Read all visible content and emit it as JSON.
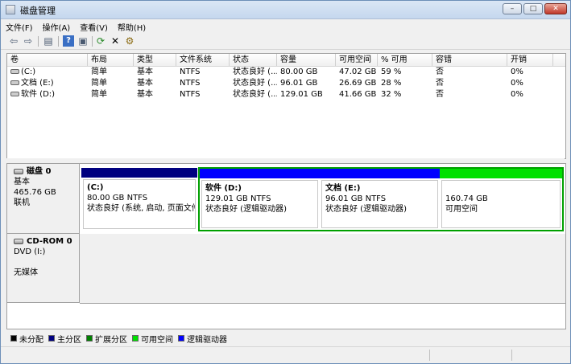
{
  "window": {
    "title": "磁盘管理",
    "buttons": [
      "–",
      "□",
      "✕"
    ]
  },
  "menu": [
    "文件(F)",
    "操作(A)",
    "查看(V)",
    "帮助(H)"
  ],
  "toolbar": {
    "icons": [
      "back-arrow-icon",
      "forward-arrow-icon",
      "properties-icon",
      "help-icon",
      "refresh-icon",
      "delete-icon",
      "settings-icon"
    ],
    "glyphs": [
      "⇦",
      "⇨",
      "▤",
      "?",
      "⟳",
      "✕",
      "⚙"
    ]
  },
  "volume_table": {
    "headers": [
      "卷",
      "布局",
      "类型",
      "文件系统",
      "状态",
      "容量",
      "可用空间",
      "% 可用",
      "容错",
      "开销"
    ],
    "rows": [
      [
        "(C:)",
        "简单",
        "基本",
        "NTFS",
        "状态良好 (...",
        "80.00 GB",
        "47.02 GB",
        "59 %",
        "否",
        "0%"
      ],
      [
        "文档 (E:)",
        "简单",
        "基本",
        "NTFS",
        "状态良好 (...",
        "96.01 GB",
        "26.69 GB",
        "28 %",
        "否",
        "0%"
      ],
      [
        "软件 (D:)",
        "简单",
        "基本",
        "NTFS",
        "状态良好 (...",
        "129.01 GB",
        "41.66 GB",
        "32 %",
        "否",
        "0%"
      ]
    ]
  },
  "disks": [
    {
      "name": "磁盘 0",
      "kind": "基本",
      "size": "465.76 GB",
      "state": "联机",
      "partitions": [
        {
          "name": "(C:)",
          "size": "80.00 GB NTFS",
          "status": "状态良好 (系统, 启动, 页面文件, 活",
          "bar_color": "#000080"
        },
        {
          "name": "软件 (D:)",
          "size": "129.01 GB NTFS",
          "status": "状态良好 (逻辑驱动器)",
          "bar_color": "#0000ff"
        },
        {
          "name": "文档 (E:)",
          "size": "96.01 GB NTFS",
          "status": "状态良好 (逻辑驱动器)",
          "bar_color": "#0000ff"
        },
        {
          "name": "",
          "size": "160.74 GB",
          "status": "可用空间",
          "bar_color": "#00e000"
        }
      ]
    },
    {
      "name": "CD-ROM 0",
      "kind": "DVD (I:)",
      "size": "",
      "state": "无媒体"
    }
  ],
  "legend": [
    {
      "label": "未分配",
      "color": "#000000"
    },
    {
      "label": "主分区",
      "color": "#000080"
    },
    {
      "label": "扩展分区",
      "color": "#008000"
    },
    {
      "label": "可用空间",
      "color": "#00e000"
    },
    {
      "label": "逻辑驱动器",
      "color": "#0000ff"
    }
  ]
}
